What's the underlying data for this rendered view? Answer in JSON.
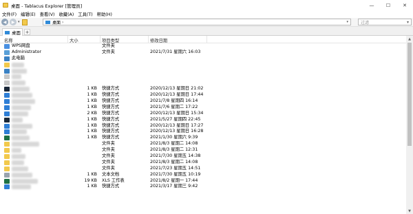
{
  "window": {
    "title": "桌面 - Tablacus Explorer [管理员]",
    "controls": {
      "minimize": "—",
      "maximize": "☐",
      "close": "✕"
    }
  },
  "menubar": [
    "文件(F)",
    "编辑(E)",
    "查看(V)",
    "收藏(A)",
    "工具(T)",
    "帮助(H)"
  ],
  "toolbar": {
    "back_glyph": "◀",
    "forward_glyph": "▶",
    "address": "桌面",
    "address_chevron": "›",
    "address_dropdown": "▾",
    "filter_placeholder": "过滤"
  },
  "tabs": [
    {
      "label": "桌面"
    }
  ],
  "tab_add": "+",
  "columns": {
    "name": "名称",
    "size": "大小",
    "type": "项目类型",
    "modified": "修改日期"
  },
  "colors": {
    "folder": "#f2c94c",
    "cloud": "#4a90e2",
    "user": "#5aa0d8",
    "pc": "#3b82c4",
    "shortcut_steam": "#1b2838",
    "shortcut_red": "#d23b2e",
    "shortcut_blue": "#2f7fd6",
    "text_doc": "#9aa4ae",
    "excel": "#1e7145",
    "generic": "#c8c8c8"
  },
  "rows": [
    {
      "name": "WPS网盘",
      "size": "",
      "type": "文件夹",
      "modified": "",
      "icon": "cloud-icon",
      "blurred": false
    },
    {
      "name": "Administrator",
      "size": "",
      "type": "文件夹",
      "modified": "2021/7/31 星期六 16:03",
      "icon": "user-folder-icon",
      "blurred": false
    },
    {
      "name": "此电脑",
      "size": "",
      "type": "",
      "modified": "",
      "icon": "computer-icon",
      "blurred": false
    },
    {
      "name": "",
      "size": "",
      "type": "",
      "modified": "",
      "icon": "folder-icon",
      "blurred": true
    },
    {
      "name": "",
      "size": "",
      "type": "",
      "modified": "",
      "icon": "network-icon",
      "blurred": true
    },
    {
      "name": "",
      "size": "",
      "type": "",
      "modified": "",
      "icon": "generic-icon",
      "blurred": true
    },
    {
      "name": "",
      "size": "",
      "type": "",
      "modified": "",
      "icon": "generic-icon",
      "blurred": true
    },
    {
      "name": "",
      "size": "1 KB",
      "type": "快捷方式",
      "modified": "2020/12/13 星期日 21:02",
      "icon": "steam-icon",
      "blurred": true
    },
    {
      "name": "",
      "size": "1 KB",
      "type": "快捷方式",
      "modified": "2020/12/13 星期日 17:44",
      "icon": "app-shortcut-icon",
      "blurred": true
    },
    {
      "name": "",
      "size": "1 KB",
      "type": "快捷方式",
      "modified": "2021/7/8 星期四 16:14",
      "icon": "app-shortcut-icon",
      "blurred": true
    },
    {
      "name": "",
      "size": "1 KB",
      "type": "快捷方式",
      "modified": "2021/7/6 星期二 17:22",
      "icon": "app-shortcut-icon",
      "blurred": true
    },
    {
      "name": "",
      "size": "2 KB",
      "type": "快捷方式",
      "modified": "2020/12/13 星期日 15:34",
      "icon": "app-shortcut-icon",
      "blurred": true
    },
    {
      "name": "",
      "size": "1 KB",
      "type": "快捷方式",
      "modified": "2021/5/27 星期四 22:45",
      "icon": "qq-icon",
      "blurred": true
    },
    {
      "name": "",
      "size": "1 KB",
      "type": "快捷方式",
      "modified": "2020/12/13 星期日 17:27",
      "icon": "app-shortcut-icon",
      "blurred": true
    },
    {
      "name": "",
      "size": "1 KB",
      "type": "快捷方式",
      "modified": "2020/12/13 星期日 16:28",
      "icon": "app-shortcut-icon",
      "blurred": true
    },
    {
      "name": "",
      "size": "1 KB",
      "type": "快捷方式",
      "modified": "2021/1/30 星期六 9:39",
      "icon": "wechat-icon",
      "blurred": true
    },
    {
      "name": "",
      "size": "",
      "type": "文件夹",
      "modified": "2021/8/3 星期二 14:08",
      "icon": "folder-icon",
      "blurred": true
    },
    {
      "name": "",
      "size": "",
      "type": "文件夹",
      "modified": "2021/8/3 星期二 12:31",
      "icon": "folder-icon",
      "blurred": true
    },
    {
      "name": "",
      "size": "",
      "type": "文件夹",
      "modified": "2021/7/30 星期五 14:38",
      "icon": "folder-icon",
      "blurred": true
    },
    {
      "name": "",
      "size": "",
      "type": "文件夹",
      "modified": "2021/8/3 星期二 14:08",
      "icon": "folder-icon",
      "blurred": true
    },
    {
      "name": "",
      "size": "",
      "type": "文件夹",
      "modified": "2021/7/23 星期五 14:51",
      "icon": "folder-icon",
      "blurred": true
    },
    {
      "name": "",
      "size": "1 KB",
      "type": "文本文档",
      "modified": "2021/7/30 星期五 10:19",
      "icon": "text-doc-icon",
      "blurred": true
    },
    {
      "name": "",
      "size": "19 KB",
      "type": "XLS 工作表",
      "modified": "2021/8/2 星期一 17:44",
      "icon": "excel-icon",
      "blurred": true
    },
    {
      "name": "",
      "size": "1 KB",
      "type": "快捷方式",
      "modified": "2021/3/17 星期三 9:42",
      "icon": "app-shortcut-icon",
      "blurred": true
    }
  ],
  "scrollbar": {
    "up": "▲",
    "down": "▼"
  }
}
